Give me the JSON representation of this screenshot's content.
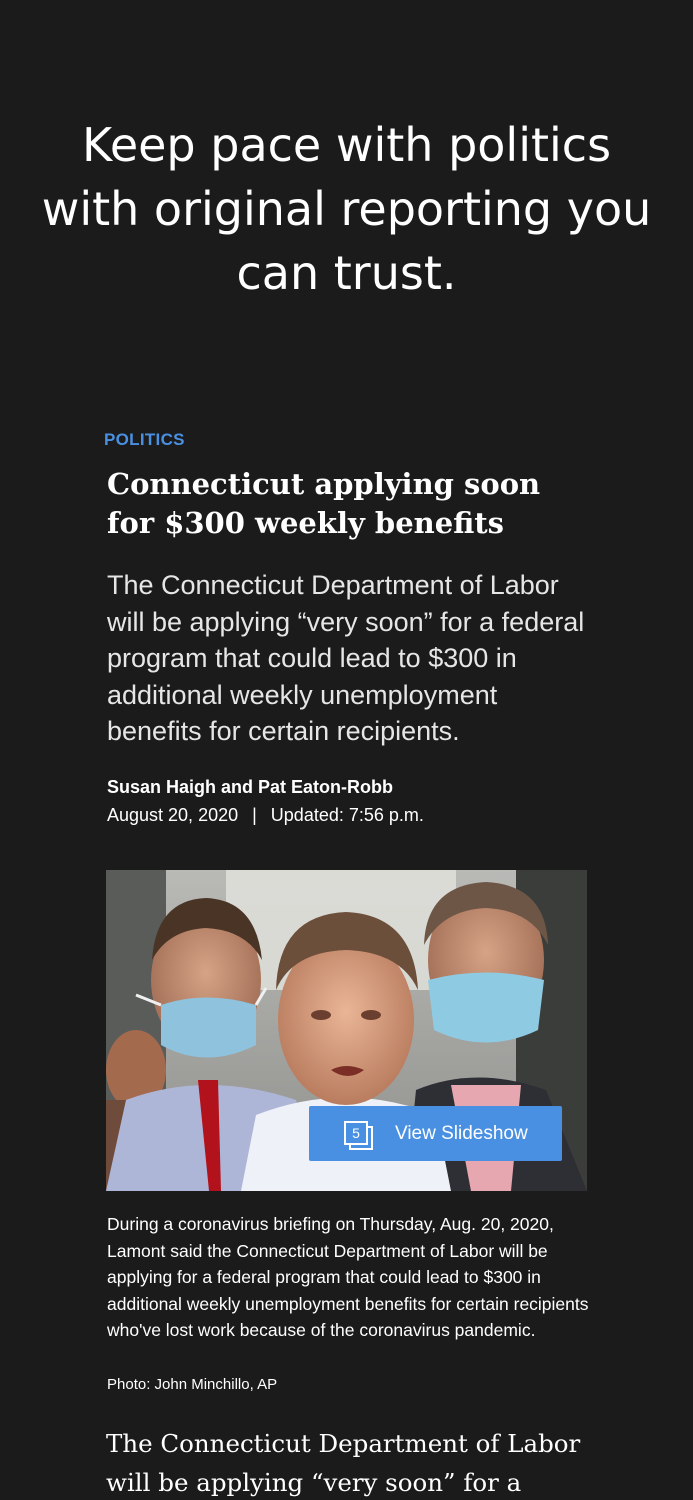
{
  "promo": {
    "headline": "Keep pace with politics with original reporting you can trust."
  },
  "article": {
    "kicker": "POLITICS",
    "headline": "Connecticut applying soon for $300 weekly benefits",
    "dek": "The Connecticut Department of Labor will be applying “very soon” for a federal program that could lead to $300 in additional weekly unemployment benefits for certain recipients.",
    "byline": "Susan Haigh and Pat Eaton-Robb",
    "date": "August 20, 2020",
    "separator": "|",
    "updated": "Updated: 7:56 p.m."
  },
  "media": {
    "slide_count": "5",
    "slideshow_label": "View Slideshow",
    "caption": "During a coronavirus briefing on Thursday, Aug. 20, 2020, Lamont said the Connecticut Department of Labor will be applying for a federal program that could lead to $300 in additional weekly unemployment benefits for certain recipients who've lost work because of the coronavirus pandemic.",
    "credit": "Photo: John Minchillo, AP"
  },
  "body": {
    "first_paragraph": "The Connecticut Department of Labor will be applying “very soon” for a federal"
  },
  "colors": {
    "background": "#1b1b1c",
    "accent": "#4a90e2",
    "text": "#ffffff"
  }
}
